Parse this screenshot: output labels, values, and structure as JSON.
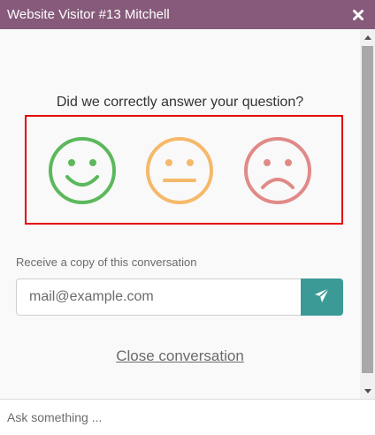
{
  "window": {
    "title": "Website Visitor #13 Mitchell",
    "close_icon": "close-icon",
    "accent_color": "#875a7b"
  },
  "rating": {
    "question": "Did we correctly answer your question?",
    "options": [
      {
        "name": "happy",
        "icon": "smiley-happy-icon",
        "color": "#5cb85c"
      },
      {
        "name": "neutral",
        "icon": "smiley-neutral-icon",
        "color": "#f0ad4e"
      },
      {
        "name": "sad",
        "icon": "smiley-sad-icon",
        "color": "#d9534f"
      }
    ],
    "highlight_color": "#e60000"
  },
  "transcript": {
    "label": "Receive a copy of this conversation",
    "email_placeholder": "mail@example.com",
    "send_icon": "paper-plane-icon",
    "send_color": "#3b9a96"
  },
  "close_link": "Close conversation",
  "composer": {
    "placeholder": "Ask something ..."
  }
}
